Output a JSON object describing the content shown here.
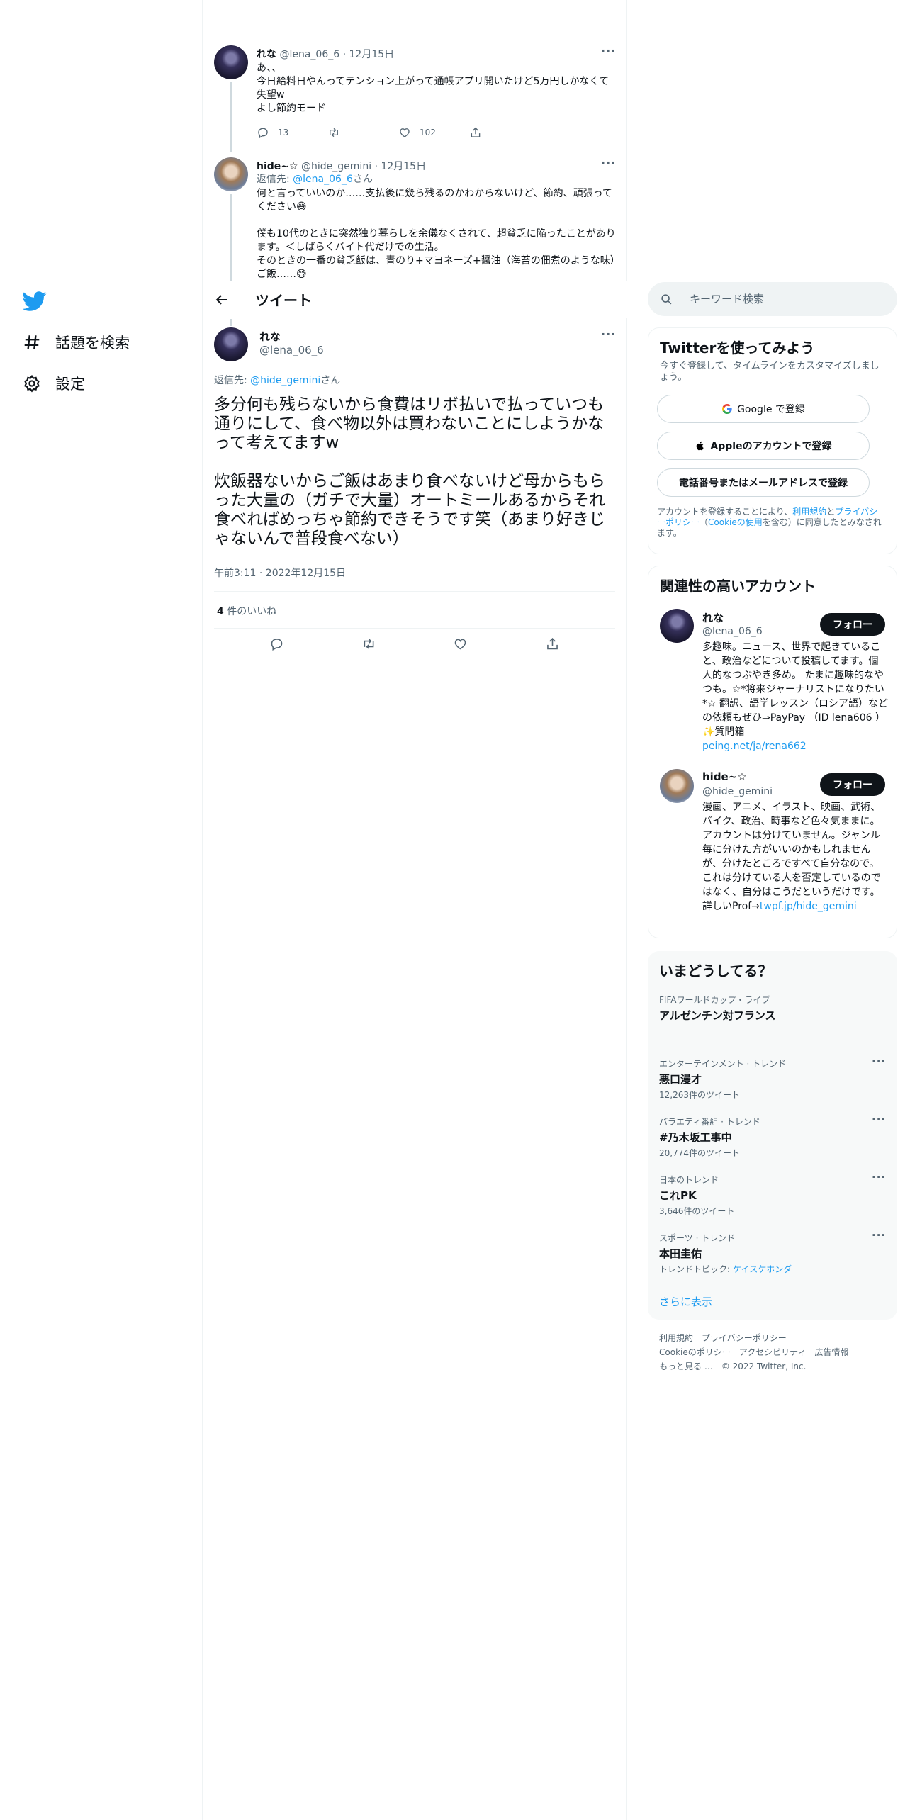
{
  "nav": {
    "explore": "話題を検索",
    "settings": "設定"
  },
  "thread": [
    {
      "name": "れな",
      "handle": "@lena_06_6",
      "date": "12月15日",
      "text": "あ、、\n今日給料日やんってテンション上がって通帳アプリ開いたけど5万円しかなくて失望w\nよし節約モード",
      "replies": "13",
      "likes": "102"
    },
    {
      "name": "hide~☆",
      "handle": "@hide_gemini",
      "date": "12月15日",
      "reply_prefix": "返信先: ",
      "reply_to": "@lena_06_6",
      "reply_suffix": "さん",
      "text": "何と言っていいのか……支払後に幾ら残るのかわからないけど、節約、頑張ってください😅\n\n僕も10代のときに突然独り暮らしを余儀なくされて、超貧乏に陥ったことがあります。＜しばらくバイト代だけでの生活。\nそのときの一番の貧乏飯は、青のり+マヨネーズ+醤油（海苔の佃煮のような味）ご飯……😅"
    }
  ],
  "header": {
    "title": "ツイート"
  },
  "focal": {
    "name": "れな",
    "handle": "@lena_06_6",
    "reply_prefix": "返信先: ",
    "reply_to": "@hide_gemini",
    "reply_suffix": "さん",
    "text": "多分何も残らないから食費はリボ払いで払っていつも通りにして、食べ物以外は買わないことにしようかなって考えてますw\n\n炊飯器ないからご飯はあまり食べないけど母からもらった大量の（ガチで大量）オートミールあるからそれ食べればめっちゃ節約できそうです笑（あまり好きじゃないんで普段食べない）",
    "timestamp": "午前3:11 · 2022年12月15日",
    "likes_count": "4",
    "likes_label": " 件のいいね"
  },
  "search": {
    "placeholder": "キーワード検索"
  },
  "signup": {
    "title": "Twitterを使ってみよう",
    "subtitle": "今すぐ登録して、タイムラインをカスタマイズしましょう。",
    "google": "Google で登録",
    "apple": "Appleのアカウントで登録",
    "phone": "電話番号またはメールアドレスで登録",
    "legal_1": "アカウントを登録することにより、",
    "legal_terms": "利用規約",
    "legal_2": "と",
    "legal_privacy": "プライバシーポリシー",
    "legal_3": "（",
    "legal_cookie": "Cookieの使用",
    "legal_4": "を含む）に同意したとみなされます。"
  },
  "related": {
    "title": "関連性の高いアカウント",
    "follow_label": "フォロー",
    "accounts": [
      {
        "name": "れな",
        "handle": "@lena_06_6",
        "bio": "多趣味。ニュース、世界で起きていること、政治などについて投稿してます。個人的なつぶやき多め。 たまに趣味的なやつも。☆*将来ジャーナリストになりたい*☆ 翻訳、語学レッスン（ロシア語）などの依頼もぜひ⇒PayPay （ID lena606 ） ✨質問箱",
        "link": "peing.net/ja/rena662"
      },
      {
        "name": "hide~☆",
        "handle": "@hide_gemini",
        "bio": "漫画、アニメ、イラスト、映画、武術、バイク、政治、時事など色々気ままに。アカウントは分けていません。ジャンル毎に分けた方がいいのかもしれませんが、分けたところですべて自分なので。これは分けている人を否定しているのではなく、自分はこうだというだけです。詳しいProf→",
        "link": "twpf.jp/hide_gemini"
      }
    ]
  },
  "trends": {
    "title": "いまどうしてる？",
    "items": [
      {
        "category": "FIFAワールドカップ・ライブ",
        "name": "アルゼンチン対フランス"
      },
      {
        "category": "エンターテインメント · トレンド",
        "name": "悪口漫才",
        "count": "12,263件のツイート"
      },
      {
        "category": "バラエティ番組 · トレンド",
        "name": "#乃木坂工事中",
        "count": "20,774件のツイート"
      },
      {
        "category": "日本のトレンド",
        "name": "これPK",
        "count": "3,646件のツイート"
      },
      {
        "category": "スポーツ · トレンド",
        "name": "本田圭佑",
        "count_prefix": "トレンドトピック: ",
        "count_link": "ケイスケホンダ"
      }
    ],
    "show_more": "さらに表示"
  },
  "footer": {
    "terms": "利用規約",
    "privacy": "プライバシーポリシー",
    "cookie": "Cookieのポリシー",
    "accessibility": "アクセシビリティ",
    "ads": "広告情報",
    "more": "もっと見る …",
    "copyright": "© 2022 Twitter, Inc."
  },
  "colors": {
    "accent": "#1d9bf0",
    "text": "#0f1419",
    "muted": "#536471",
    "border": "#eff3f4"
  }
}
